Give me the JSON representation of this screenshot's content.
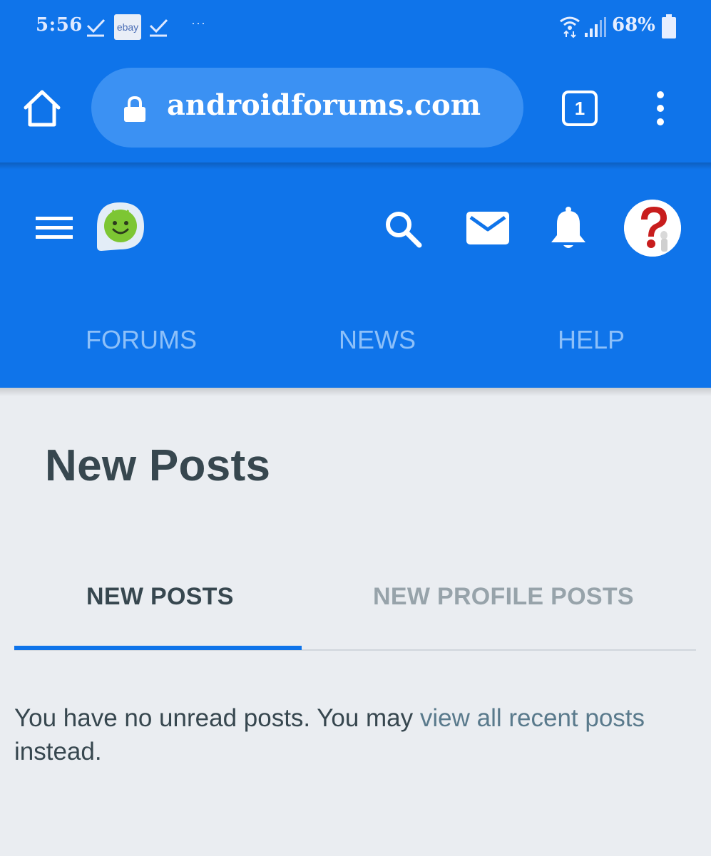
{
  "status_bar": {
    "time": "5:56",
    "ebay_label": "ebay",
    "more": "···",
    "battery_pct": "68%"
  },
  "browser": {
    "url": "androidforums.com",
    "tab_count": "1"
  },
  "site_header": {
    "nav": [
      {
        "label": "FORUMS"
      },
      {
        "label": "NEWS"
      },
      {
        "label": "HELP"
      }
    ]
  },
  "main": {
    "title": "New Posts",
    "tabs": [
      {
        "label": "NEW POSTS",
        "active": true
      },
      {
        "label": "NEW PROFILE POSTS",
        "active": false
      }
    ],
    "notice_prefix": "You have no unread posts. You may ",
    "notice_link": "view all recent posts",
    "notice_suffix": " instead."
  },
  "colors": {
    "brand_blue": "#0f74ea",
    "page_bg": "#eaedf1",
    "text_dark": "#37474f",
    "link": "#5a7a8c"
  }
}
